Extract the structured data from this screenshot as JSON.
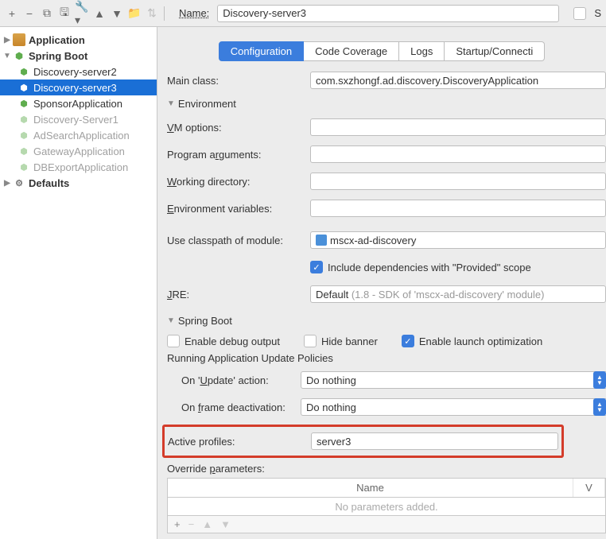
{
  "toolbar": {
    "name_label": "Name:",
    "name_value": "Discovery-server3",
    "share_partial": "S"
  },
  "tree": {
    "application": "Application",
    "springboot": "Spring Boot",
    "items": [
      {
        "label": "Discovery-server2",
        "muted": false
      },
      {
        "label": "Discovery-server3",
        "muted": false,
        "selected": true
      },
      {
        "label": "SponsorApplication",
        "muted": false
      },
      {
        "label": "Discovery-Server1",
        "muted": true
      },
      {
        "label": "AdSearchApplication",
        "muted": true
      },
      {
        "label": "GatewayApplication",
        "muted": true
      },
      {
        "label": "DBExportApplication",
        "muted": true
      }
    ],
    "defaults": "Defaults"
  },
  "tabs": [
    "Configuration",
    "Code Coverage",
    "Logs",
    "Startup/Connecti"
  ],
  "form": {
    "main_class_label": "Main class:",
    "main_class_value": "com.sxzhongf.ad.discovery.DiscoveryApplication",
    "env_header": "Environment",
    "vm_label": "VM options:",
    "prog_args_label": "Program arguments:",
    "wd_label": "Working directory:",
    "env_vars_label": "Environment variables:",
    "ucom_label": "Use classpath of module:",
    "ucom_value": "mscx-ad-discovery",
    "include_provided": "Include dependencies with \"Provided\" scope",
    "jre_label": "JRE:",
    "jre_value": "Default",
    "jre_hint": "(1.8 - SDK of 'mscx-ad-discovery' module)",
    "sb_header": "Spring Boot",
    "enable_debug": "Enable debug output",
    "hide_banner": "Hide banner",
    "enable_launch_opt": "Enable launch optimization",
    "policies_header": "Running Application Update Policies",
    "on_update_label": "On 'Update' action:",
    "on_update_value": "Do nothing",
    "on_frame_label": "On frame deactivation:",
    "on_frame_value": "Do nothing",
    "active_profiles_label": "Active profiles:",
    "active_profiles_value": "server3",
    "override_label": "Override parameters:",
    "table_name": "Name",
    "table_v": "V",
    "no_params": "No parameters added."
  }
}
